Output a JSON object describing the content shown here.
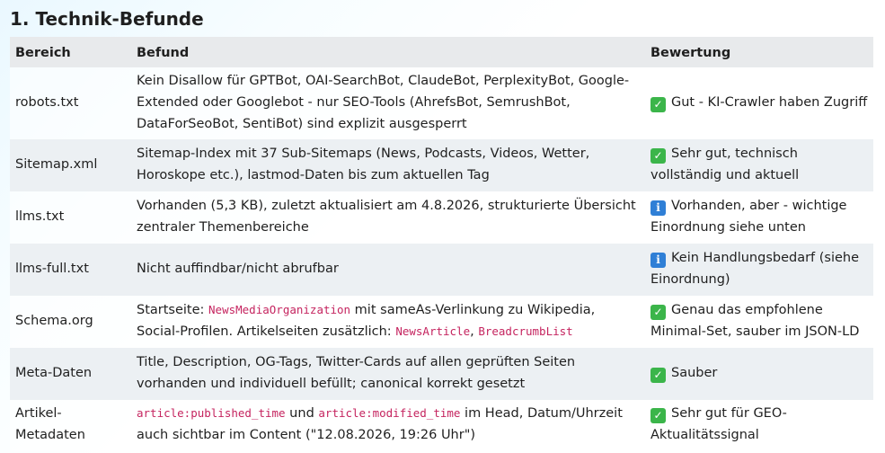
{
  "heading": "1. Technik-Befunde",
  "colors": {
    "header_bg": "#e8eaec",
    "row_alt_bg": "#ecf0f3",
    "code_color": "#c5245f",
    "check_badge": "#3bb54a",
    "info_badge": "#2f7fd6"
  },
  "table": {
    "headers": [
      "Bereich",
      "Befund",
      "Bewertung"
    ],
    "rows": [
      {
        "area": "robots.txt",
        "finding": [
          {
            "text": "Kein Disallow für GPTBot, OAI-SearchBot, ClaudeBot, PerplexityBot, Google-Extended oder Googlebot - nur SEO-Tools (AhrefsBot, SemrushBot, DataForSeoBot, SentiBot) sind explizit ausgesperrt"
          }
        ],
        "icon": "check-mark-icon",
        "icon_glyph": "✓",
        "rating": "Gut - KI-Crawler haben Zugriff"
      },
      {
        "area": "Sitemap.xml",
        "finding": [
          {
            "text": "Sitemap-Index mit 37 Sub-Sitemaps (News, Podcasts, Videos, Wetter, Horoskope etc.), lastmod-Daten bis zum aktuellen Tag"
          }
        ],
        "icon": "check-mark-icon",
        "icon_glyph": "✓",
        "rating": "Sehr gut, technisch vollständig und aktuell"
      },
      {
        "area": "llms.txt",
        "finding": [
          {
            "text": "Vorhanden (5,3 KB), zuletzt aktualisiert am 4.8.2026, strukturierte Übersicht zentraler Themenbereiche"
          }
        ],
        "icon": "info-icon",
        "icon_glyph": "i",
        "rating": "Vorhanden, aber - wichtige Einordnung siehe unten"
      },
      {
        "area": "llms-full.txt",
        "finding": [
          {
            "text": "Nicht auffindbar/nicht abrufbar"
          }
        ],
        "icon": "info-icon",
        "icon_glyph": "i",
        "rating": "Kein Handlungsbedarf (siehe Einordnung)"
      },
      {
        "area": "Schema.org",
        "finding": [
          {
            "text": "Startseite: "
          },
          {
            "code": "NewsMediaOrganization"
          },
          {
            "text": " mit sameAs-Verlinkung zu Wikipedia, Social-Profilen. Artikelseiten zusätzlich: "
          },
          {
            "code": "NewsArticle"
          },
          {
            "text": ", "
          },
          {
            "code": "BreadcrumbList"
          }
        ],
        "icon": "check-mark-icon",
        "icon_glyph": "✓",
        "rating": "Genau das empfohlene Minimal-Set, sauber im JSON-LD"
      },
      {
        "area": "Meta-Daten",
        "finding": [
          {
            "text": "Title, Description, OG-Tags, Twitter-Cards auf allen geprüften Seiten vorhanden und individuell befüllt; canonical korrekt gesetzt"
          }
        ],
        "icon": "check-mark-icon",
        "icon_glyph": "✓",
        "rating": "Sauber"
      },
      {
        "area": "Artikel-Metadaten",
        "finding": [
          {
            "code": "article:published_time"
          },
          {
            "text": " und "
          },
          {
            "code": "article:modified_time"
          },
          {
            "text": " im Head, Datum/Uhrzeit auch sichtbar im Content (\"12.08.2026, 19:26 Uhr\")"
          }
        ],
        "icon": "check-mark-icon",
        "icon_glyph": "✓",
        "rating": "Sehr gut für GEO-Aktualitätssignal"
      }
    ]
  }
}
